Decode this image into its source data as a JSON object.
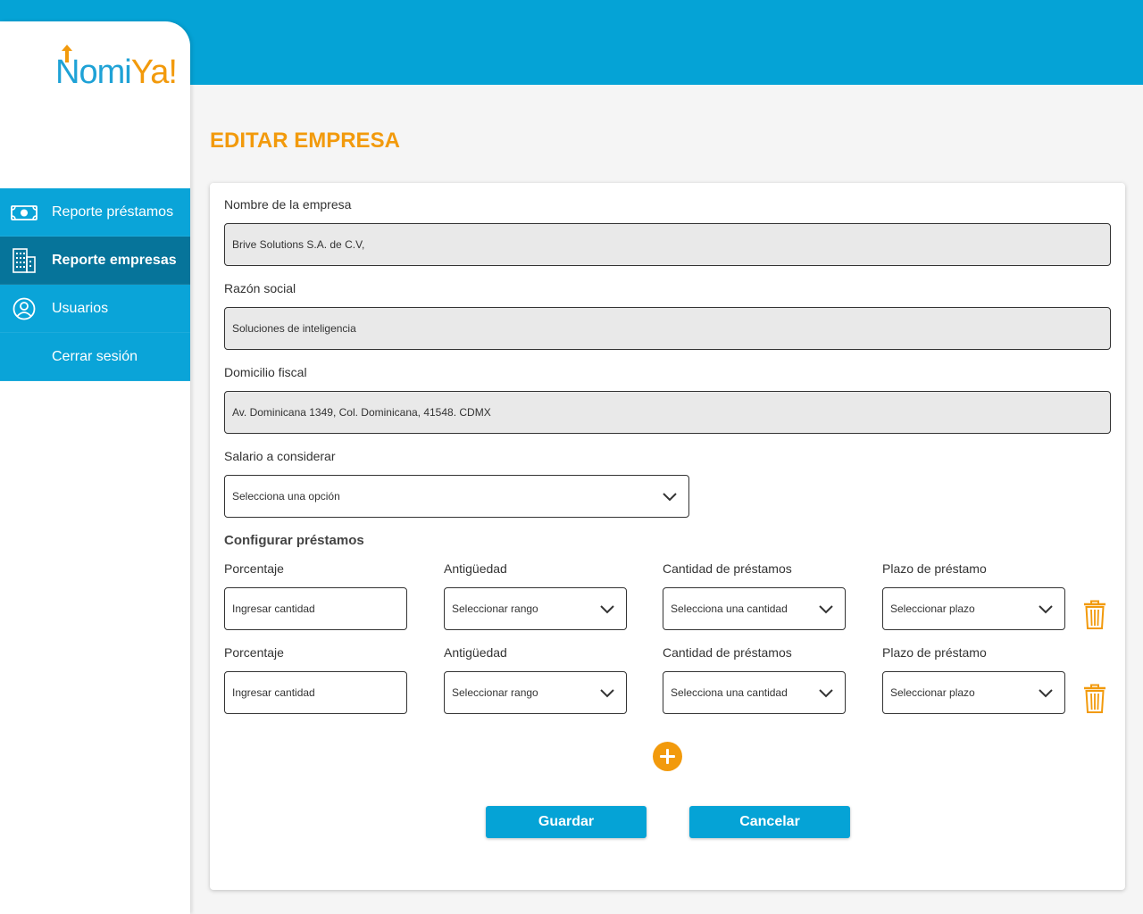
{
  "brand": {
    "logo_part1": "Nomi",
    "logo_part2": "Ya!"
  },
  "sidebar": {
    "items": [
      {
        "label": "Reporte préstamos",
        "icon": "money-bill-icon",
        "active": false
      },
      {
        "label": "Reporte empresas",
        "icon": "building-icon",
        "active": true
      },
      {
        "label": "Usuarios",
        "icon": "user-circle-icon",
        "active": false
      },
      {
        "label": "Cerrar sesión",
        "icon": "",
        "active": false
      }
    ]
  },
  "page": {
    "title": "EDITAR EMPRESA"
  },
  "form": {
    "company_name": {
      "label": "Nombre de la empresa",
      "value": "Brive Solutions S.A. de C.V,"
    },
    "business_name": {
      "label": "Razón social",
      "value": "Soluciones de inteligencia"
    },
    "fiscal_address": {
      "label": "Domicilio fiscal",
      "value": "Av. Dominicana 1349, Col. Dominicana, 41548. CDMX"
    },
    "salary": {
      "label": "Salario a considerar",
      "placeholder": "Selecciona una opción"
    },
    "loans_section_title": "Configurar préstamos",
    "loan_rows": [
      {
        "percentage_label": "Porcentaje",
        "percentage_placeholder": "Ingresar cantidad",
        "seniority_label": "Antigüedad",
        "seniority_placeholder": "Seleccionar rango",
        "count_label": "Cantidad de préstamos",
        "count_placeholder": "Selecciona una cantidad",
        "term_label": "Plazo de préstamo",
        "term_placeholder": "Seleccionar plazo"
      },
      {
        "percentage_label": "Porcentaje",
        "percentage_placeholder": "Ingresar cantidad",
        "seniority_label": "Antigüedad",
        "seniority_placeholder": "Seleccionar rango",
        "count_label": "Cantidad de préstamos",
        "count_placeholder": "Selecciona una cantidad",
        "term_label": "Plazo de préstamo",
        "term_placeholder": "Seleccionar plazo"
      }
    ]
  },
  "actions": {
    "save_label": "Guardar",
    "cancel_label": "Cancelar"
  },
  "colors": {
    "primary": "#05a3d6",
    "sidebar_active": "#06749a",
    "accent": "#f29a0c"
  }
}
